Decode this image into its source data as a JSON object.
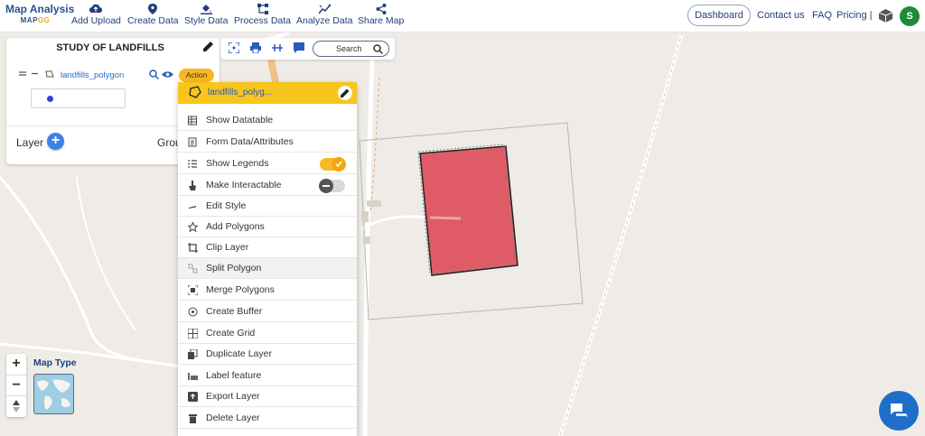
{
  "brand": {
    "line1": "Map Analysis",
    "line2_prefix": "MAP",
    "line2_suffix": "OG"
  },
  "nav": [
    {
      "label": "Add Upload",
      "icon": "cloud-upload-icon"
    },
    {
      "label": "Create Data",
      "icon": "map-pin-icon"
    },
    {
      "label": "Style Data",
      "icon": "paint-bucket-icon"
    },
    {
      "label": "Process Data",
      "icon": "process-icon"
    },
    {
      "label": "Analyze Data",
      "icon": "analyze-icon"
    },
    {
      "label": "Share Map",
      "icon": "share-icon"
    }
  ],
  "header_right": {
    "dashboard": "Dashboard",
    "contact": "Contact us",
    "faq": "FAQ",
    "pricing": "Pricing |",
    "avatar_letter": "S"
  },
  "panel": {
    "title": "STUDY OF LANDFILLS",
    "layer_name": "landfills_polygon",
    "action_label": "Action",
    "layer_label": "Layer",
    "group_label": "Grou"
  },
  "toolbar": {
    "search_label": "Search"
  },
  "menu": {
    "header": "landfills_polyg...",
    "items": [
      {
        "label": "Show Datatable",
        "icon": "table-icon"
      },
      {
        "label": "Form Data/Attributes",
        "icon": "form-icon"
      },
      {
        "label": "Show Legends",
        "icon": "list-icon",
        "toggle": true
      },
      {
        "label": "Make Interactable",
        "icon": "pointer-icon",
        "toggle": false
      },
      {
        "label": "Edit Style",
        "icon": "brush-icon"
      },
      {
        "label": "Add Polygons",
        "icon": "star-icon"
      },
      {
        "label": "Clip Layer",
        "icon": "crop-icon"
      },
      {
        "label": "Split Polygon",
        "icon": "split-icon"
      },
      {
        "label": "Merge Polygons",
        "icon": "merge-icon"
      },
      {
        "label": "Create Buffer",
        "icon": "buffer-icon"
      },
      {
        "label": "Create Grid",
        "icon": "grid-icon"
      },
      {
        "label": "Duplicate Layer",
        "icon": "duplicate-icon"
      },
      {
        "label": "Label feature",
        "icon": "label-icon"
      },
      {
        "label": "Export Layer",
        "icon": "export-icon"
      },
      {
        "label": "Delete Layer",
        "icon": "trash-icon"
      }
    ]
  },
  "map_controls": {
    "zoom_in": "+",
    "zoom_out": "−",
    "map_type_label": "Map Type"
  },
  "colors": {
    "accent": "#f7c51c",
    "brand_blue": "#2a5191",
    "polygon_fill": "#df5c66"
  }
}
